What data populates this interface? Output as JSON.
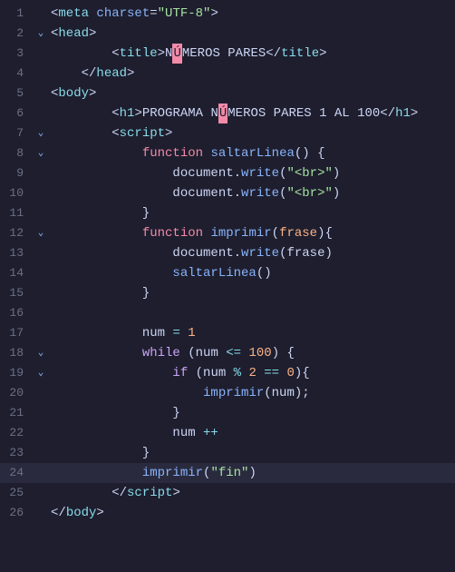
{
  "lines": [
    {
      "num": 1,
      "collapse": "",
      "tokens": [
        {
          "cls": "tag-bracket",
          "text": "<"
        },
        {
          "cls": "tag",
          "text": "meta"
        },
        {
          "cls": "plain",
          "text": " "
        },
        {
          "cls": "attr-name",
          "text": "charset"
        },
        {
          "cls": "punct",
          "text": "="
        },
        {
          "cls": "attr-value",
          "text": "\"UTF-8\""
        },
        {
          "cls": "tag-bracket",
          "text": ">"
        }
      ]
    },
    {
      "num": 2,
      "collapse": "v",
      "tokens": [
        {
          "cls": "tag-bracket",
          "text": "<"
        },
        {
          "cls": "tag",
          "text": "head"
        },
        {
          "cls": "tag-bracket",
          "text": ">"
        }
      ]
    },
    {
      "num": 3,
      "collapse": "",
      "indent": "        ",
      "tokens": [
        {
          "cls": "tag-bracket",
          "text": "<"
        },
        {
          "cls": "tag",
          "text": "title"
        },
        {
          "cls": "tag-bracket",
          "text": ">"
        },
        {
          "cls": "plain",
          "text": "N"
        },
        {
          "cls": "highlight-box",
          "text": "Ú"
        },
        {
          "cls": "plain",
          "text": "MEROS PARES"
        },
        {
          "cls": "tag-bracket",
          "text": "</"
        },
        {
          "cls": "tag",
          "text": "title"
        },
        {
          "cls": "tag-bracket",
          "text": ">"
        }
      ]
    },
    {
      "num": 4,
      "collapse": "",
      "indent": "    ",
      "tokens": [
        {
          "cls": "tag-bracket",
          "text": "</"
        },
        {
          "cls": "tag",
          "text": "head"
        },
        {
          "cls": "tag-bracket",
          "text": ">"
        }
      ]
    },
    {
      "num": 5,
      "collapse": "",
      "tokens": [
        {
          "cls": "tag-bracket",
          "text": "<"
        },
        {
          "cls": "tag",
          "text": "body"
        },
        {
          "cls": "tag-bracket",
          "text": ">"
        }
      ]
    },
    {
      "num": 6,
      "collapse": "",
      "indent": "        ",
      "tokens": [
        {
          "cls": "tag-bracket",
          "text": "<"
        },
        {
          "cls": "tag",
          "text": "h1"
        },
        {
          "cls": "tag-bracket",
          "text": ">"
        },
        {
          "cls": "plain",
          "text": "PROGRAMA N"
        },
        {
          "cls": "highlight-box",
          "text": "Ú"
        },
        {
          "cls": "plain",
          "text": "MEROS PARES 1 AL 100"
        },
        {
          "cls": "tag-bracket",
          "text": "</"
        },
        {
          "cls": "tag",
          "text": "h1"
        },
        {
          "cls": "tag-bracket",
          "text": ">"
        }
      ]
    },
    {
      "num": 7,
      "collapse": "v",
      "indent": "        ",
      "tokens": [
        {
          "cls": "tag-bracket",
          "text": "<"
        },
        {
          "cls": "tag",
          "text": "script"
        },
        {
          "cls": "tag-bracket",
          "text": ">"
        }
      ]
    },
    {
      "num": 8,
      "collapse": "v",
      "indent": "            ",
      "tokens": [
        {
          "cls": "keyword",
          "text": "function"
        },
        {
          "cls": "plain",
          "text": " "
        },
        {
          "cls": "fn-name",
          "text": "saltarLinea"
        },
        {
          "cls": "punct",
          "text": "() {"
        }
      ]
    },
    {
      "num": 9,
      "collapse": "",
      "indent": "                ",
      "tokens": [
        {
          "cls": "plain",
          "text": "document."
        },
        {
          "cls": "method",
          "text": "write"
        },
        {
          "cls": "punct",
          "text": "("
        },
        {
          "cls": "string",
          "text": "\"<br>\""
        },
        {
          "cls": "punct",
          "text": ")"
        }
      ]
    },
    {
      "num": 10,
      "collapse": "",
      "indent": "                ",
      "tokens": [
        {
          "cls": "plain",
          "text": "document."
        },
        {
          "cls": "method",
          "text": "write"
        },
        {
          "cls": "punct",
          "text": "("
        },
        {
          "cls": "string",
          "text": "\"<br>\""
        },
        {
          "cls": "punct",
          "text": ")"
        }
      ]
    },
    {
      "num": 11,
      "collapse": "",
      "indent": "            ",
      "tokens": [
        {
          "cls": "punct",
          "text": "}"
        }
      ]
    },
    {
      "num": 12,
      "collapse": "v",
      "indent": "            ",
      "tokens": [
        {
          "cls": "keyword",
          "text": "function"
        },
        {
          "cls": "plain",
          "text": " "
        },
        {
          "cls": "fn-name",
          "text": "imprimir"
        },
        {
          "cls": "punct",
          "text": "("
        },
        {
          "cls": "param",
          "text": "frase"
        },
        {
          "cls": "punct",
          "text": "){"
        }
      ]
    },
    {
      "num": 13,
      "collapse": "",
      "indent": "                ",
      "tokens": [
        {
          "cls": "plain",
          "text": "document."
        },
        {
          "cls": "method",
          "text": "write"
        },
        {
          "cls": "punct",
          "text": "(frase)"
        }
      ]
    },
    {
      "num": 14,
      "collapse": "",
      "indent": "                ",
      "tokens": [
        {
          "cls": "fn-name",
          "text": "saltarLinea"
        },
        {
          "cls": "punct",
          "text": "()"
        }
      ]
    },
    {
      "num": 15,
      "collapse": "",
      "indent": "            ",
      "tokens": [
        {
          "cls": "punct",
          "text": "}"
        }
      ]
    },
    {
      "num": 16,
      "collapse": "",
      "tokens": []
    },
    {
      "num": 17,
      "collapse": "",
      "indent": "            ",
      "tokens": [
        {
          "cls": "plain",
          "text": "num "
        },
        {
          "cls": "operator",
          "text": "="
        },
        {
          "cls": "plain",
          "text": " "
        },
        {
          "cls": "number-val",
          "text": "1"
        }
      ]
    },
    {
      "num": 18,
      "collapse": "v",
      "indent": "            ",
      "tokens": [
        {
          "cls": "keyword2",
          "text": "while"
        },
        {
          "cls": "plain",
          "text": " (num "
        },
        {
          "cls": "operator",
          "text": "<="
        },
        {
          "cls": "plain",
          "text": " "
        },
        {
          "cls": "number-val",
          "text": "100"
        },
        {
          "cls": "punct",
          "text": ") {"
        }
      ]
    },
    {
      "num": 19,
      "collapse": "v",
      "indent": "                ",
      "tokens": [
        {
          "cls": "keyword2",
          "text": "if"
        },
        {
          "cls": "plain",
          "text": " (num "
        },
        {
          "cls": "operator",
          "text": "%"
        },
        {
          "cls": "plain",
          "text": " "
        },
        {
          "cls": "number-val",
          "text": "2"
        },
        {
          "cls": "plain",
          "text": " "
        },
        {
          "cls": "operator",
          "text": "=="
        },
        {
          "cls": "plain",
          "text": " "
        },
        {
          "cls": "number-val",
          "text": "0"
        },
        {
          "cls": "punct",
          "text": "){"
        }
      ]
    },
    {
      "num": 20,
      "collapse": "",
      "indent": "                    ",
      "tokens": [
        {
          "cls": "fn-name",
          "text": "imprimir"
        },
        {
          "cls": "punct",
          "text": "(num);"
        }
      ]
    },
    {
      "num": 21,
      "collapse": "",
      "indent": "                ",
      "tokens": [
        {
          "cls": "punct",
          "text": "}"
        }
      ]
    },
    {
      "num": 22,
      "collapse": "",
      "indent": "                ",
      "tokens": [
        {
          "cls": "plain",
          "text": "num "
        },
        {
          "cls": "operator",
          "text": "++"
        }
      ]
    },
    {
      "num": 23,
      "collapse": "",
      "indent": "            ",
      "tokens": [
        {
          "cls": "punct",
          "text": "}"
        }
      ]
    },
    {
      "num": 24,
      "collapse": "",
      "indent": "            ",
      "active": true,
      "tokens": [
        {
          "cls": "fn-name",
          "text": "imprimir"
        },
        {
          "cls": "punct",
          "text": "("
        },
        {
          "cls": "string",
          "text": "\"fin\""
        },
        {
          "cls": "punct",
          "text": ")"
        }
      ]
    },
    {
      "num": 25,
      "collapse": "",
      "indent": "        ",
      "tokens": [
        {
          "cls": "tag-bracket",
          "text": "</"
        },
        {
          "cls": "tag",
          "text": "script"
        },
        {
          "cls": "tag-bracket",
          "text": ">"
        }
      ]
    },
    {
      "num": 26,
      "collapse": "",
      "tokens": [
        {
          "cls": "tag-bracket",
          "text": "</"
        },
        {
          "cls": "tag",
          "text": "body"
        },
        {
          "cls": "tag-bracket",
          "text": ">"
        }
      ]
    }
  ]
}
